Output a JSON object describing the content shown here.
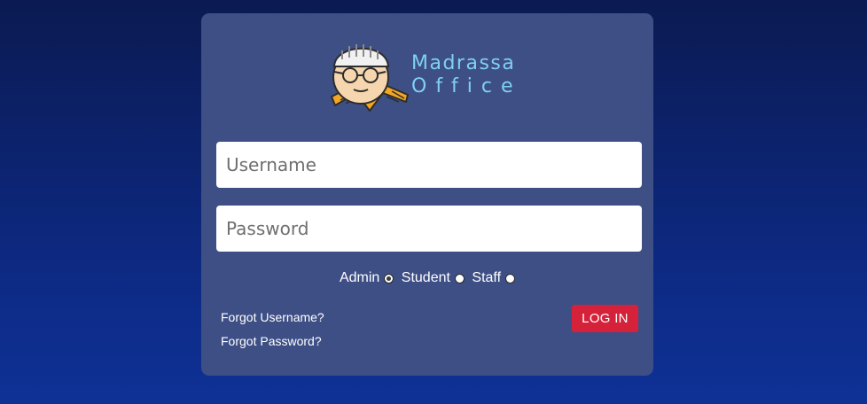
{
  "brand": {
    "line1": "Madrassa",
    "line2": "Office",
    "mascot_icon": "madrassa-mascot-icon"
  },
  "form": {
    "username_placeholder": "Username",
    "password_placeholder": "Password",
    "roles": [
      {
        "label": "Admin",
        "selected": true
      },
      {
        "label": "Student",
        "selected": false
      },
      {
        "label": "Staff",
        "selected": false
      }
    ],
    "forgot_username": "Forgot Username?",
    "forgot_password": "Forgot Password?",
    "login_label": "LOG IN"
  },
  "colors": {
    "card_bg": "#3e4f86",
    "accent_text": "#7fd0f2",
    "login_button": "#d6213a"
  }
}
